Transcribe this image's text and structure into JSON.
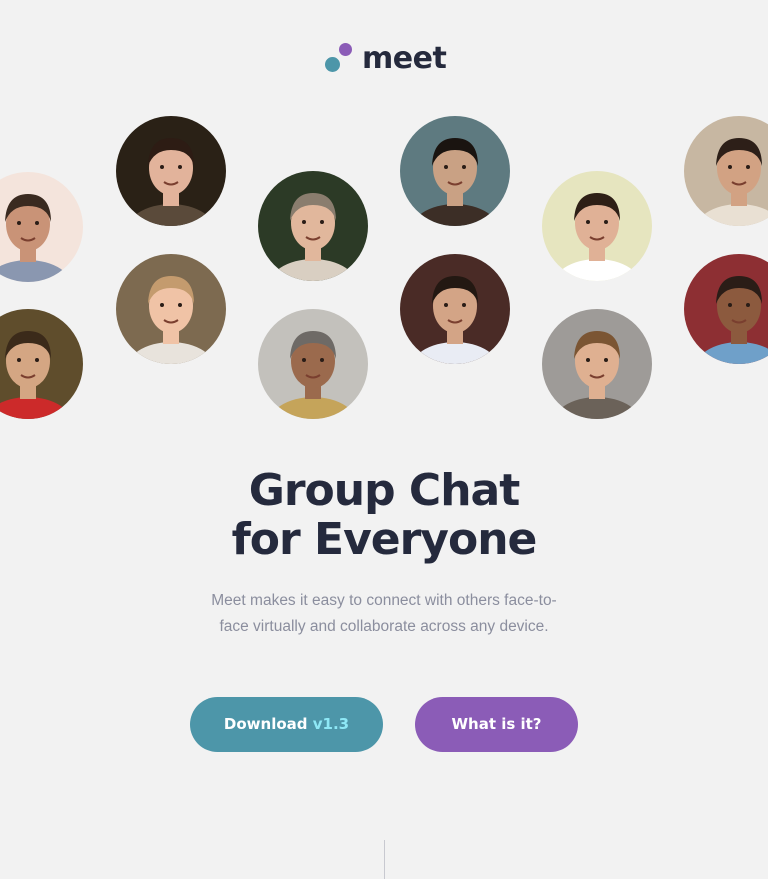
{
  "brand": {
    "name": "meet",
    "colors": {
      "teal": "#4d96a9",
      "purple": "#8b5cb7",
      "dark": "#252a3d",
      "version_accent": "#8ee8f6",
      "text_muted": "#8b8e9e",
      "background": "#f2f2f2"
    }
  },
  "avatars": [
    {
      "name": "avatar-person-1",
      "bg": "#f4e4dc",
      "skin": "#c99377",
      "hair": "#3a2a20",
      "shirt": "#8a97b0"
    },
    {
      "name": "avatar-person-2",
      "bg": "#2a2116",
      "skin": "#e2b39b",
      "hair": "#2d1c14",
      "shirt": "#5a4a3a"
    },
    {
      "name": "avatar-person-3",
      "bg": "#2c3a26",
      "skin": "#e1b79c",
      "hair": "#8a7d6e",
      "shirt": "#d9cfc2"
    },
    {
      "name": "avatar-person-4",
      "bg": "#5e7a80",
      "skin": "#c9a184",
      "hair": "#1a1410",
      "shirt": "#3c2e26"
    },
    {
      "name": "avatar-person-5",
      "bg": "#e6e5bf",
      "skin": "#e0b196",
      "hair": "#2e1f16",
      "shirt": "#ffffff"
    },
    {
      "name": "avatar-person-6",
      "bg": "#c7b7a2",
      "skin": "#d2a283",
      "hair": "#2d1f18",
      "shirt": "#e9e0d3"
    },
    {
      "name": "avatar-person-7",
      "bg": "#5f4d2c",
      "skin": "#d4a683",
      "hair": "#3b2a1a",
      "shirt": "#cc2a2a"
    },
    {
      "name": "avatar-person-8",
      "bg": "#7d6a50",
      "skin": "#f0c3a6",
      "hair": "#c49b6e",
      "shirt": "#e8e3dc"
    },
    {
      "name": "avatar-person-9",
      "bg": "#c3c1bc",
      "skin": "#9b6a4d",
      "hair": "#6e6a66",
      "shirt": "#c5a45a"
    },
    {
      "name": "avatar-person-10",
      "bg": "#4a2b26",
      "skin": "#d3a486",
      "hair": "#231812",
      "shirt": "#e9ecf4"
    },
    {
      "name": "avatar-person-11",
      "bg": "#9e9b98",
      "skin": "#dfb091",
      "hair": "#7b5533",
      "shirt": "#6b6259"
    },
    {
      "name": "avatar-person-12",
      "bg": "#8d2f33",
      "skin": "#8c5a3e",
      "hair": "#2a1d17",
      "shirt": "#6fa0c9"
    }
  ],
  "hero": {
    "headline_line1": "Group Chat",
    "headline_line2": "for Everyone",
    "subtitle": "Meet makes it easy to connect with others face-to-face virtually and collaborate across any device."
  },
  "buttons": {
    "download_label": "Download",
    "download_version": "v1.3",
    "what_label": "What is it?"
  }
}
